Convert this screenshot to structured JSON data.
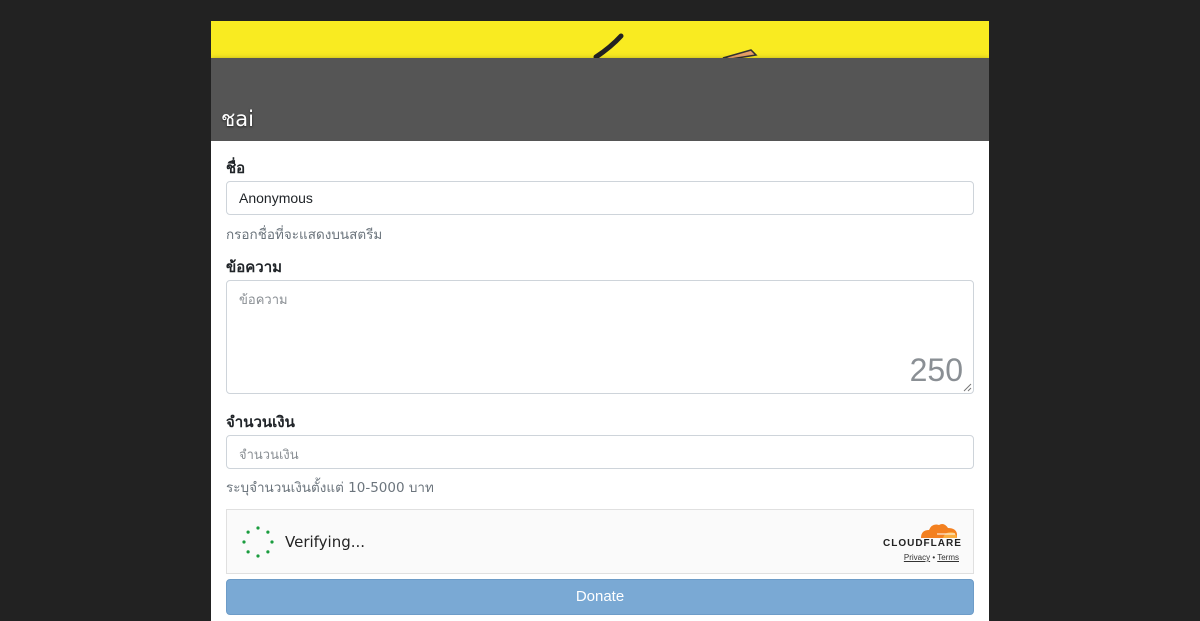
{
  "streamer": {
    "name": "ชai"
  },
  "form": {
    "name": {
      "label": "ชื่อ",
      "value": "Anonymous",
      "help": "กรอกชื่อที่จะแสดงบนสตรีม"
    },
    "message": {
      "label": "ข้อความ",
      "placeholder": "ข้อความ",
      "counter": "250"
    },
    "amount": {
      "label": "จำนวนเงิน",
      "placeholder": "จำนวนเงิน",
      "help": "ระบุจำนวนเงินตั้งแต่ 10-5000 บาท"
    },
    "captcha": {
      "status": "Verifying...",
      "brand": "CLOUDFLARE",
      "privacy_label": "Privacy",
      "separator": "•",
      "terms_label": "Terms"
    },
    "donate_label": "Donate"
  },
  "colors": {
    "page_background": "#222222",
    "banner_yellow": "#f9eb21",
    "overlay_gray": "#555555",
    "button_blue": "#7aa9d4",
    "spinner_green": "#1a9c3e",
    "cloudflare_orange": "#f38020"
  },
  "icons": [
    "spinner-icon",
    "cloudflare-cloud-icon",
    "resize-grip-icon"
  ]
}
